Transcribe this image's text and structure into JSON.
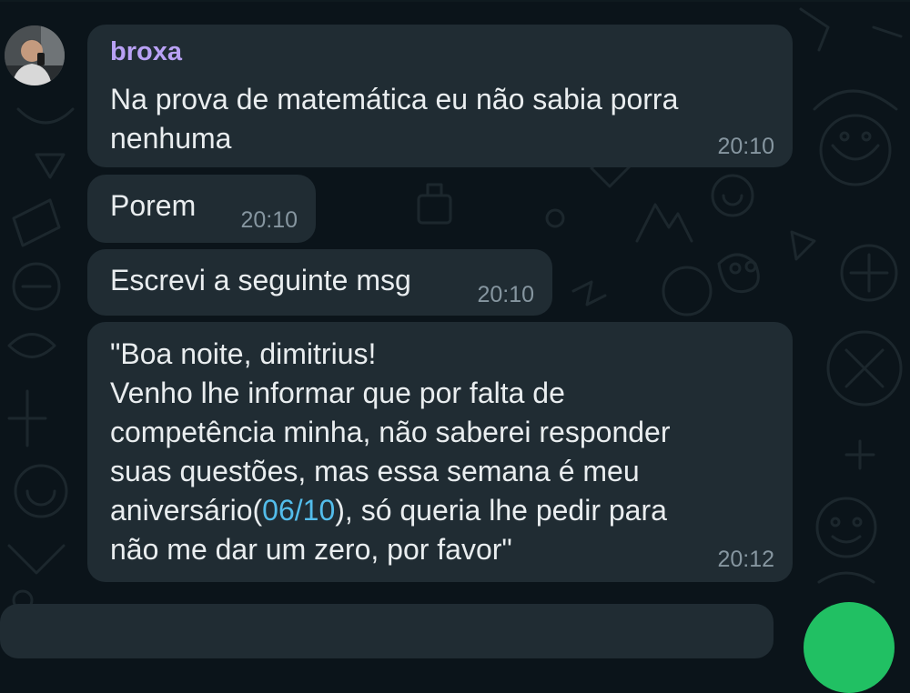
{
  "chat": {
    "messages": [
      {
        "sender": "broxa",
        "text": "Na prova de matemática eu não sabia porra\nnenhuma",
        "time": "20:10"
      },
      {
        "text": "Porem",
        "time": "20:10"
      },
      {
        "text": "Escrevi a seguinte msg",
        "time": "20:10"
      },
      {
        "text_before": "\"Boa noite, dimitrius!\nVenho lhe informar que por falta de\ncompetência minha, não saberei responder\nsuas questões,  mas essa semana é meu\naniversário(",
        "link": "06/10",
        "text_after": "), só queria lhe pedir para\nnão me dar um zero, por favor\"",
        "time": "20:12"
      }
    ]
  },
  "colors": {
    "background": "#0b141a",
    "bubble": "#202c33",
    "sender_name": "#b9a1f5",
    "timestamp": "#8696a0",
    "link": "#53bdeb",
    "fab": "#21c063"
  },
  "icons": {
    "avatar": "user-avatar-photo",
    "fab": "scroll-fab-button"
  }
}
